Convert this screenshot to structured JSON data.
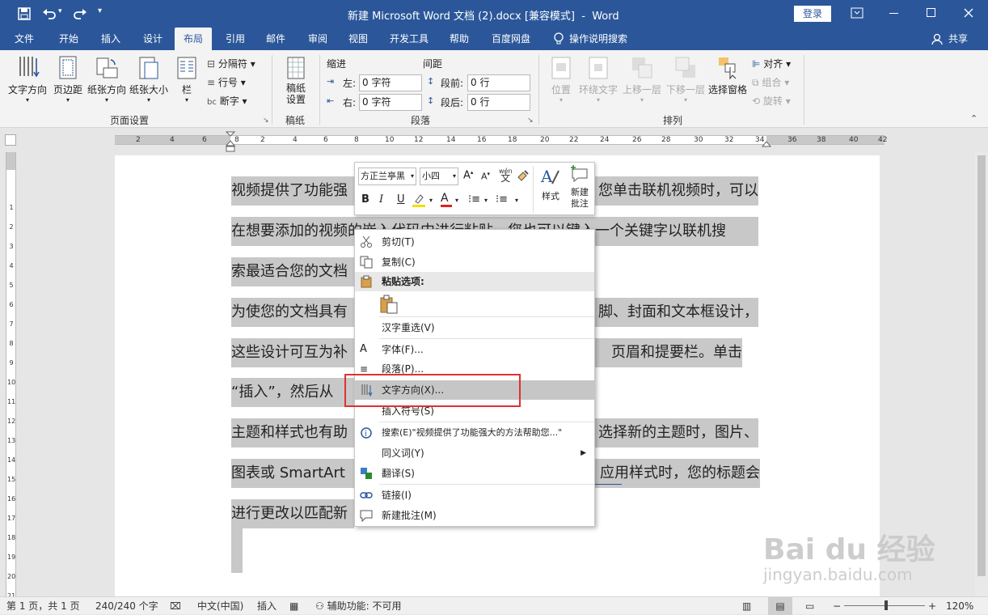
{
  "title": {
    "text": "新建 Microsoft Word 文档 (2).docx [兼容模式]  -  Word",
    "login": "登录"
  },
  "qat": {
    "save": "save-icon",
    "undo": "undo-icon",
    "redo": "redo-icon"
  },
  "tabs": [
    "文件",
    "开始",
    "插入",
    "设计",
    "布局",
    "引用",
    "邮件",
    "审阅",
    "视图",
    "开发工具",
    "帮助",
    "百度网盘",
    "操作说明搜索"
  ],
  "share": "共享",
  "ribbon": {
    "page_setup": {
      "text_dir": "文字方向",
      "margins": "页边距",
      "orient": "纸张方向",
      "size": "纸张大小",
      "columns": "栏",
      "breaks": "分隔符",
      "line_numbers": "行号",
      "hyphen": "断字",
      "label": "页面设置"
    },
    "manuscript": {
      "btn": "稿纸设置",
      "label": "稿纸"
    },
    "paragraph": {
      "indent": "缩进",
      "spacing": "间距",
      "left": "左:",
      "right": "右:",
      "before": "段前:",
      "after": "段后:",
      "left_val": "0 字符",
      "right_val": "0 字符",
      "before_val": "0 行",
      "after_val": "0 行",
      "label": "段落"
    },
    "arrange": {
      "position": "位置",
      "wrap": "环绕文字",
      "forward": "上移一层",
      "backward": "下移一层",
      "pane": "选择窗格",
      "align": "对齐",
      "group": "组合",
      "rotate": "旋转",
      "label": "排列"
    }
  },
  "ruler": [
    "2",
    "4",
    "6",
    "8",
    "2",
    "4",
    "6",
    "8",
    "10",
    "12",
    "14",
    "16",
    "18",
    "20",
    "22",
    "24",
    "26",
    "28",
    "30",
    "32",
    "34",
    "36",
    "38",
    "40",
    "42"
  ],
  "doc": {
    "lines": [
      "视频提供了功能强大的方法帮助您证明您的观点。当您单击联机视频时，可以",
      "在想要添加的视频的嵌入代码中进行粘贴。您也可以键入一个关键字以联机搜",
      "索最适合您的文档的视频。",
      "为使您的文档具有专业外观，Word 提供了页眉、页脚、封面和文本框设计，",
      "这些设计可互为补充。例如，您可以添加匹配的封面、页眉和提要栏。单击",
      "“插入”，然后从不同库中选择所需元素。",
      "主题和样式也有助于文档保持协调。当您单击设计并选择新的主题时，图片、",
      "图表或 SmartArt 图形将会更改以匹配新的主题。当应用样式时，您的标题会",
      "进行更改以匹配新的主题。"
    ],
    "visible": [
      [
        "视频提供了功能强",
        "您单击联机视频时，可以"
      ],
      [
        "在想要添加的视频的嵌入代码中进行粘贴。您也可以键入一个关键字以联机搜"
      ],
      [
        "索最适合您的文档"
      ],
      [
        "为使您的文档具有",
        "脚、封面和文本框设计，"
      ],
      [
        "这些设计可互为补",
        "页眉和提要栏。单击"
      ],
      [
        "“插入”，然后从"
      ],
      [
        "主题和样式也有助",
        "选择新的主题时，图片、"
      ],
      [
        "图表或 SmartArt",
        "应用样式时，您的标题会"
      ],
      [
        "进行更改以匹配新"
      ]
    ]
  },
  "mini": {
    "font": "方正兰亭黑",
    "size": "小四",
    "styles": "样式",
    "comment1": "新建",
    "comment2": "批注",
    "bold": "B",
    "italic": "I",
    "underline": "U",
    "fontcolor": "A"
  },
  "context": {
    "cut": "剪切(T)",
    "copy": "复制(C)",
    "paste_opts": "粘贴选项:",
    "reconvert": "汉字重选(V)",
    "font": "字体(F)...",
    "paragraph": "段落(P)...",
    "text_direction": "文字方向(X)...",
    "insert_symbol": "插入符号(S)",
    "search": "搜索(E)\"视频提供了功能强大的方法帮助您...\"",
    "synonyms": "同义词(Y)",
    "translate": "翻译(S)",
    "link": "链接(I)",
    "new_comment": "新建批注(M)"
  },
  "status": {
    "page": "第 1 页，共 1 页",
    "words": "240/240 个字",
    "lang": "中文(中国)",
    "insert": "插入",
    "access": "辅助功能: 不可用",
    "zoom": "120%"
  },
  "watermark": {
    "brand": "Bai du 经验",
    "url": "jingyan.baidu.com"
  },
  "colors": {
    "accent": "#2b579a",
    "highlight": "#c8c8c8",
    "redbox": "#e03030"
  }
}
